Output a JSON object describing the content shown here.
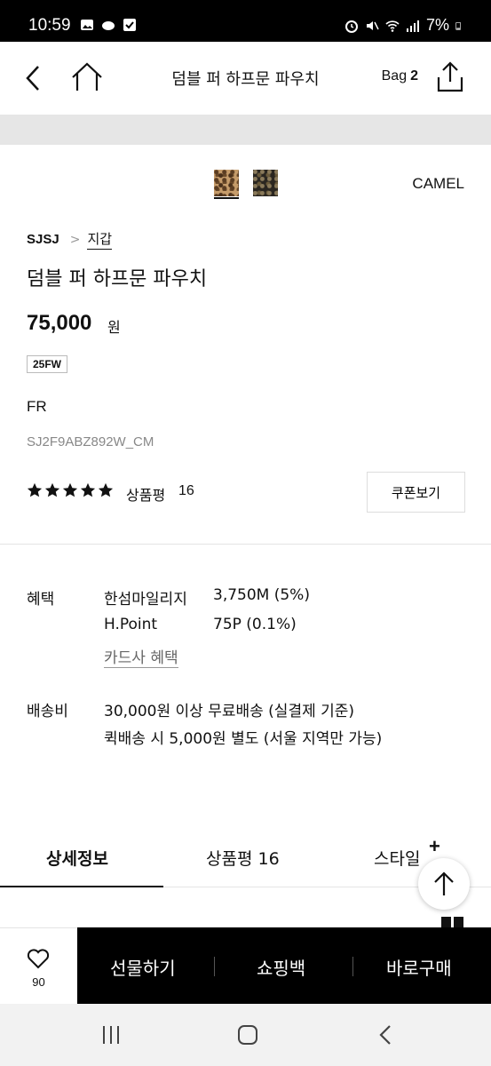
{
  "status": {
    "time": "10:59",
    "battery": "7%"
  },
  "nav": {
    "title": "덤블 퍼 하프문 파우치",
    "bag_label": "Bag",
    "bag_count": "2"
  },
  "colors": {
    "selected": "CAMEL",
    "swatches": [
      "camel-leopard",
      "dark-leopard"
    ]
  },
  "product": {
    "brand": "SJSJ",
    "category": "지갑",
    "name": "덤블 퍼 하프문 파우치",
    "price": "75,000",
    "price_unit": "원",
    "season": "25FW",
    "origin": "FR",
    "code": "SJ2F9ABZ892W_CM",
    "rating_stars": 5,
    "review_label": "상품평",
    "review_count": "16",
    "coupon_button": "쿠폰보기"
  },
  "benefits": {
    "label": "혜택",
    "rows": [
      {
        "name": "한섬마일리지",
        "value": "3,750M (5%)"
      },
      {
        "name": "H.Point",
        "value": "75P (0.1%)"
      }
    ],
    "card_link": "카드사 혜택"
  },
  "shipping": {
    "label": "배송비",
    "line1": "30,000원 이상 무료배송 (실결제 기준)",
    "line2": "퀵배송 시 5,000원 별도 (서울 지역만 가능)"
  },
  "tabs": {
    "detail": "상세정보",
    "review": "상품평 16",
    "style": "스타일",
    "style_plus": "+"
  },
  "bottom": {
    "wish_count": "90",
    "gift": "선물하기",
    "bag": "쇼핑백",
    "buy": "바로구매"
  }
}
